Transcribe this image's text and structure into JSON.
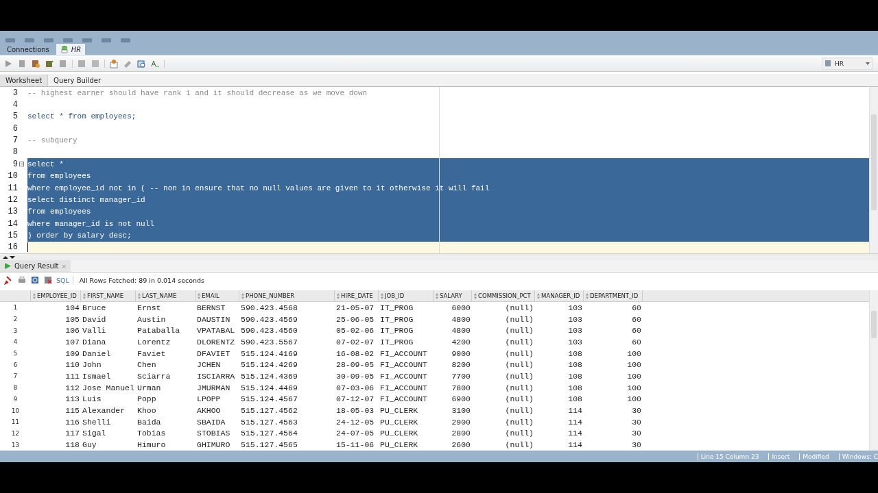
{
  "document_tabs": [
    {
      "label": "Connections",
      "selected": false
    },
    {
      "label": "HR",
      "selected": true
    }
  ],
  "connection_selector": {
    "value": "HR"
  },
  "worksheet_tabs": [
    {
      "label": "Worksheet",
      "selected": true
    },
    {
      "label": "Query Builder",
      "selected": false
    }
  ],
  "editor": {
    "lines": [
      {
        "number": "3",
        "text": "-- highest earner should have rank 1 and it should decrease as we move down",
        "kind": "comment",
        "selected": false,
        "current": false,
        "foldable": false
      },
      {
        "number": "4",
        "selected": false,
        "current": false,
        "foldable": false
      },
      {
        "number": "5",
        "text": "select * from employees;",
        "kind": "code",
        "selected": false,
        "current": false,
        "foldable": false
      },
      {
        "number": "6",
        "selected": false,
        "current": false,
        "foldable": false
      },
      {
        "number": "7",
        "text": "-- subquery",
        "kind": "comment",
        "selected": false,
        "current": false,
        "foldable": false
      },
      {
        "number": "8",
        "selected": false,
        "current": false,
        "foldable": false
      },
      {
        "number": "9",
        "text": "select *",
        "kind": "code",
        "selected": true,
        "current": false,
        "foldable": true
      },
      {
        "number": "10",
        "text": "from employees",
        "kind": "code",
        "selected": true,
        "current": false,
        "foldable": false
      },
      {
        "number": "11",
        "text": "where employee_id not in ( -- non in ensure that no null values are given to it otherwise it will fail",
        "kind": "code",
        "selected": true,
        "current": false,
        "foldable": false
      },
      {
        "number": "12",
        "text": "select distinct manager_id",
        "kind": "code",
        "selected": true,
        "current": false,
        "foldable": false
      },
      {
        "number": "13",
        "text": "from employees",
        "kind": "code",
        "selected": true,
        "current": false,
        "foldable": false
      },
      {
        "number": "14",
        "text": "where manager_id is not null",
        "kind": "code",
        "selected": true,
        "current": false,
        "foldable": false
      },
      {
        "number": "15",
        "text": ") order by salary desc;",
        "kind": "code",
        "selected": true,
        "current": false,
        "foldable": false
      },
      {
        "number": "16",
        "selected": false,
        "current": true,
        "foldable": false
      }
    ]
  },
  "result_tab": {
    "label": "Query Result",
    "close": "×"
  },
  "result_toolbar": {
    "sql_label": "SQL",
    "message": "All Rows Fetched: 89 in 0.014 seconds"
  },
  "table": {
    "columns": [
      {
        "label": "EMPLOYEE_ID",
        "kind": "number"
      },
      {
        "label": "FIRST_NAME",
        "kind": "text"
      },
      {
        "label": "LAST_NAME",
        "kind": "text"
      },
      {
        "label": "EMAIL",
        "kind": "text"
      },
      {
        "label": "PHONE_NUMBER",
        "kind": "text"
      },
      {
        "label": "HIRE_DATE",
        "kind": "text"
      },
      {
        "label": "JOB_ID",
        "kind": "text"
      },
      {
        "label": "SALARY",
        "kind": "number"
      },
      {
        "label": "COMMISSION_PCT",
        "kind": "number"
      },
      {
        "label": "MANAGER_ID",
        "kind": "number"
      },
      {
        "label": "DEPARTMENT_ID",
        "kind": "number"
      }
    ],
    "rows": [
      {
        "number": "1",
        "cells": [
          "104",
          "Bruce",
          "Ernst",
          "BERNST",
          "590.423.4568",
          "21-05-07",
          "IT_PROG",
          "6000",
          "(null)",
          "103",
          "60"
        ]
      },
      {
        "number": "2",
        "cells": [
          "105",
          "David",
          "Austin",
          "DAUSTIN",
          "590.423.4569",
          "25-06-05",
          "IT_PROG",
          "4800",
          "(null)",
          "103",
          "60"
        ]
      },
      {
        "number": "3",
        "cells": [
          "106",
          "Valli",
          "Pataballa",
          "VPATABAL",
          "590.423.4560",
          "05-02-06",
          "IT_PROG",
          "4800",
          "(null)",
          "103",
          "60"
        ]
      },
      {
        "number": "4",
        "cells": [
          "107",
          "Diana",
          "Lorentz",
          "DLORENTZ",
          "590.423.5567",
          "07-02-07",
          "IT_PROG",
          "4200",
          "(null)",
          "103",
          "60"
        ]
      },
      {
        "number": "5",
        "cells": [
          "109",
          "Daniel",
          "Faviet",
          "DFAVIET",
          "515.124.4169",
          "16-08-02",
          "FI_ACCOUNT",
          "9000",
          "(null)",
          "108",
          "100"
        ]
      },
      {
        "number": "6",
        "cells": [
          "110",
          "John",
          "Chen",
          "JCHEN",
          "515.124.4269",
          "28-09-05",
          "FI_ACCOUNT",
          "8200",
          "(null)",
          "108",
          "100"
        ]
      },
      {
        "number": "7",
        "cells": [
          "111",
          "Ismael",
          "Sciarra",
          "ISCIARRA",
          "515.124.4369",
          "30-09-05",
          "FI_ACCOUNT",
          "7700",
          "(null)",
          "108",
          "100"
        ]
      },
      {
        "number": "8",
        "cells": [
          "112",
          "Jose Manuel",
          "Urman",
          "JMURMAN",
          "515.124.4469",
          "07-03-06",
          "FI_ACCOUNT",
          "7800",
          "(null)",
          "108",
          "100"
        ]
      },
      {
        "number": "9",
        "cells": [
          "113",
          "Luis",
          "Popp",
          "LPOPP",
          "515.124.4567",
          "07-12-07",
          "FI_ACCOUNT",
          "6900",
          "(null)",
          "108",
          "100"
        ]
      },
      {
        "number": "10",
        "cells": [
          "115",
          "Alexander",
          "Khoo",
          "AKHOO",
          "515.127.4562",
          "18-05-03",
          "PU_CLERK",
          "3100",
          "(null)",
          "114",
          "30"
        ]
      },
      {
        "number": "11",
        "cells": [
          "116",
          "Shelli",
          "Baida",
          "SBAIDA",
          "515.127.4563",
          "24-12-05",
          "PU_CLERK",
          "2900",
          "(null)",
          "114",
          "30"
        ]
      },
      {
        "number": "12",
        "cells": [
          "117",
          "Sigal",
          "Tobias",
          "STOBIAS",
          "515.127.4564",
          "24-07-05",
          "PU_CLERK",
          "2800",
          "(null)",
          "114",
          "30"
        ]
      },
      {
        "number": "13",
        "cells": [
          "118",
          "Guy",
          "Himuro",
          "GHIMURO",
          "515.127.4565",
          "15-11-06",
          "PU_CLERK",
          "2600",
          "(null)",
          "114",
          "30"
        ]
      }
    ]
  },
  "status_bar": [
    "Line 15 Column 23",
    "Insert",
    "Modified",
    "Windows: C"
  ]
}
